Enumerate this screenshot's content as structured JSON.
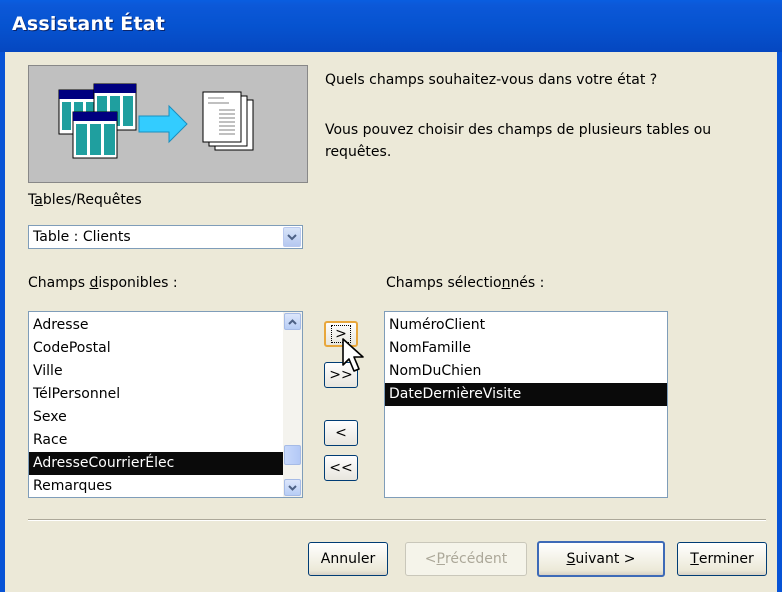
{
  "window": {
    "title": "Assistant État"
  },
  "intro": {
    "question": "Quels champs souhaitez-vous dans votre état ?",
    "hint_line1": "Vous pouvez choisir des champs de plusieurs tables ou",
    "hint_line2": "requêtes."
  },
  "tables": {
    "label_pre": "T",
    "label_ul": "a",
    "label_post": "bles/Requêtes",
    "selected": "Table : Clients"
  },
  "available": {
    "label_pre": "Champs ",
    "label_ul": "d",
    "label_post": "isponibles :",
    "items": [
      "Adresse",
      "CodePostal",
      "Ville",
      "TélPersonnel",
      "Sexe",
      "Race",
      "AdresseCourrierÉlec",
      "Remarques"
    ],
    "selected_item": "AdresseCourrierÉlec"
  },
  "selected": {
    "label_pre": "Champs sélectio",
    "label_ul": "n",
    "label_post": "nés :",
    "items": [
      "NuméroClient",
      "NomFamille",
      "NomDuChien",
      "DateDernièreVisite"
    ],
    "selected_item": "DateDernièreVisite"
  },
  "move_buttons": {
    "add_one": ">",
    "add_all": ">>",
    "remove_one": "<",
    "remove_all": "<<"
  },
  "buttons": {
    "cancel": "Annuler",
    "back_pre": "< ",
    "back_ul": "P",
    "back_post": "récédent",
    "next_ul": "S",
    "next_post": "uivant >",
    "finish_ul": "T",
    "finish_post": "erminer"
  },
  "colors": {
    "titlebar": "#0653d0",
    "selection": "#0a0a0a",
    "arrow": "#33ccff"
  }
}
